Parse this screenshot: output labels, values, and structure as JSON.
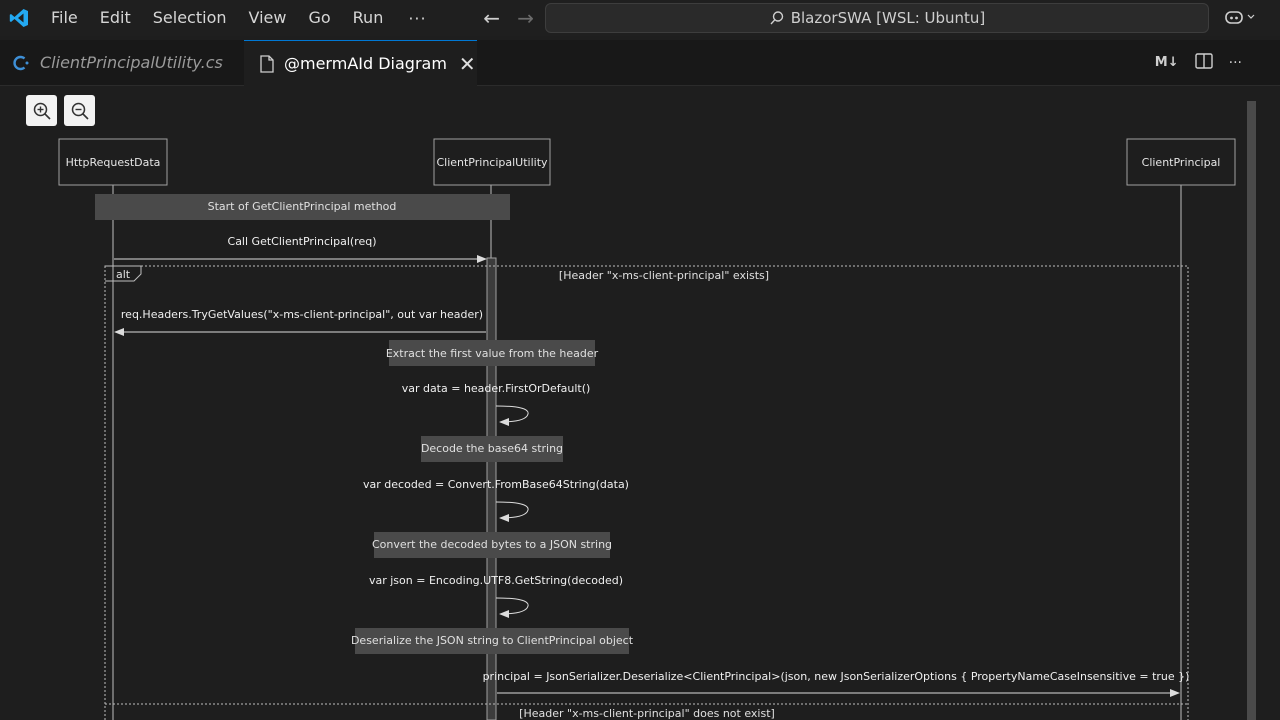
{
  "titlebar": {
    "menu": [
      "File",
      "Edit",
      "Selection",
      "View",
      "Go",
      "Run"
    ],
    "more": "···",
    "command_center": "BlazorSWA [WSL: Ubuntu]"
  },
  "tabs": [
    {
      "label": "ClientPrincipalUtility.cs"
    },
    {
      "label": "@mermAId Diagram"
    }
  ],
  "tab_actions": {
    "markdown": "M↓",
    "more": "···"
  },
  "diagram": {
    "actors": [
      "HttpRequestData",
      "ClientPrincipalUtility",
      "ClientPrincipal"
    ],
    "notes": [
      "Start of GetClientPrincipal method",
      "Extract the first value from the header",
      "Decode the base64 string",
      "Convert the decoded bytes to a JSON string",
      "Deserialize the JSON string to ClientPrincipal object"
    ],
    "messages": [
      "Call GetClientPrincipal(req)",
      "req.Headers.TryGetValues(\"x-ms-client-principal\", out var header)",
      "var data = header.FirstOrDefault()",
      "var decoded = Convert.FromBase64String(data)",
      "var json = Encoding.UTF8.GetString(decoded)",
      "principal = JsonSerializer.Deserialize<ClientPrincipal>(json, new JsonSerializerOptions { PropertyNameCaseInsensitive = true })"
    ],
    "alt": {
      "label": "alt",
      "condition_1": "[Header \"x-ms-client-principal\" exists]",
      "condition_2": "[Header \"x-ms-client-principal\" does not exist]"
    }
  },
  "colors": {
    "accent": "#0078d4",
    "vscode_blue": "#23a9f2",
    "csharp_icon": "#3e8fd6",
    "editor_bg": "#1e1e1e",
    "note_bg": "#4a4a4a"
  },
  "icons": [
    "vscode-logo-icon",
    "arrow-left-icon",
    "arrow-right-icon",
    "search-icon",
    "copilot-icon",
    "csharp-file-icon",
    "file-icon",
    "close-icon",
    "split-editor-icon",
    "more-icon",
    "zoom-in-icon",
    "zoom-out-icon"
  ]
}
